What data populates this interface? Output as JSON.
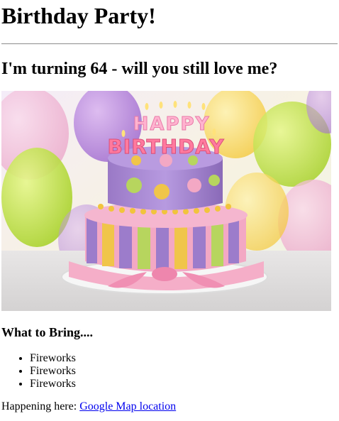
{
  "page": {
    "title": "Birthday Party!",
    "subtitle": "I'm turning 64 - will you still love me?",
    "image": {
      "alt": "Birthday cake with Happy Birthday candles",
      "candle_text": [
        "HAPPY",
        "BIRTHDAY"
      ]
    },
    "bring": {
      "heading": "What to Bring....",
      "items": [
        "Fireworks",
        "Fireworks",
        "Fireworks"
      ]
    },
    "location": {
      "label": "Happening here: ",
      "link_text": "Google Map location"
    }
  }
}
